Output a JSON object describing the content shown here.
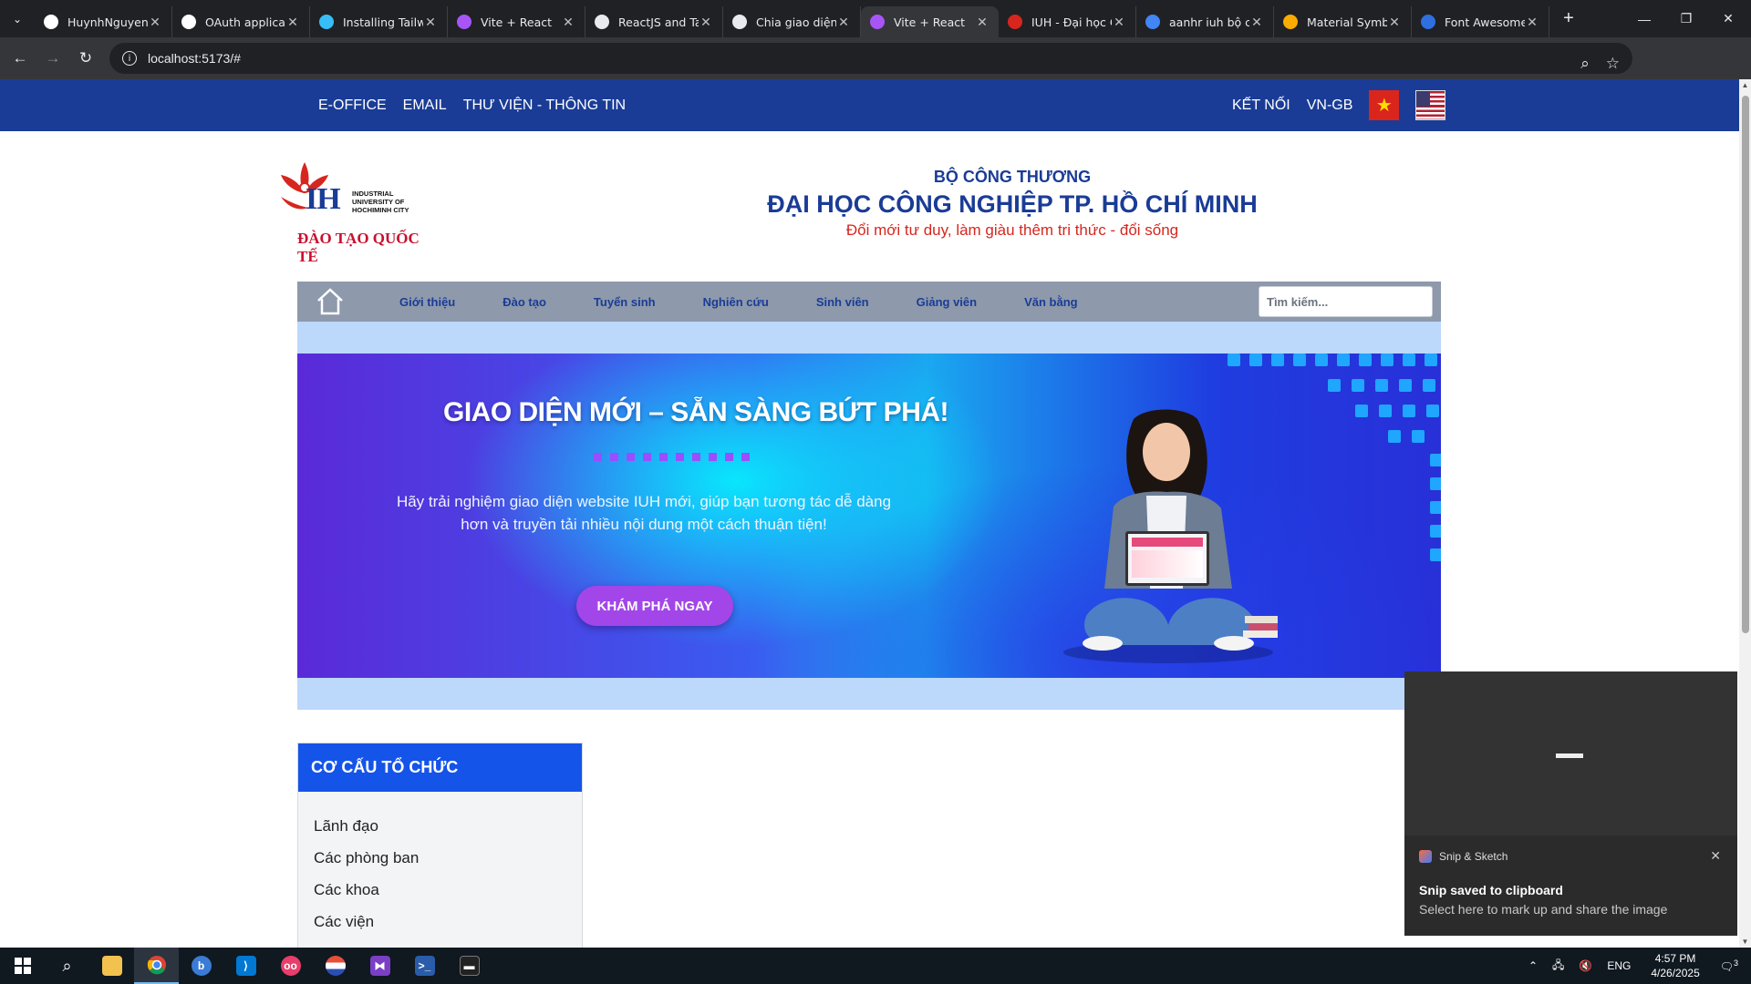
{
  "browser": {
    "tabs": [
      {
        "title": "HuynhNguyenl",
        "icon": "github-icon",
        "active": false
      },
      {
        "title": "OAuth applicat",
        "icon": "github-icon",
        "active": false
      },
      {
        "title": "Installing Tailw",
        "icon": "tailwind-icon",
        "active": false
      },
      {
        "title": "Vite + React",
        "icon": "vite-icon",
        "active": false
      },
      {
        "title": "ReactJS and Ta",
        "icon": "chatgpt-icon",
        "active": false
      },
      {
        "title": "Chia giao diện",
        "icon": "chatgpt-icon",
        "active": false
      },
      {
        "title": "Vite + React",
        "icon": "vite-icon",
        "active": true
      },
      {
        "title": "IUH - Đại học C",
        "icon": "iuh-icon",
        "active": false
      },
      {
        "title": "aanhr iuh bộ cô",
        "icon": "google-icon",
        "active": false
      },
      {
        "title": "Material Symb",
        "icon": "material-icon",
        "active": false
      },
      {
        "title": "Font Awesome",
        "icon": "fontawesome-icon",
        "active": false
      }
    ],
    "url": "localhost:5173/#"
  },
  "site": {
    "topbar": {
      "left_links": [
        "E-OFFICE",
        "EMAIL",
        "THƯ VIỆN - THÔNG TIN"
      ],
      "right_links": [
        "KẾT NỐI",
        "VN-GB"
      ]
    },
    "logo": {
      "mark": "IH",
      "university_lines": "INDUSTRIAL UNIVERSITY OF HOCHIMINH CITY",
      "tagline": "ĐÀO TẠO QUỐC TẾ"
    },
    "header": {
      "ministry": "BỘ CÔNG THƯƠNG",
      "university": "ĐẠI HỌC CÔNG NGHIỆP TP. HỒ CHÍ MINH",
      "slogan": "Đổi mới tư duy, làm giàu thêm tri thức - đổi sống"
    },
    "nav": {
      "items": [
        "Giới thiệu",
        "Đào tạo",
        "Tuyển sinh",
        "Nghiên cứu",
        "Sinh viên",
        "Giảng viên",
        "Văn bằng"
      ],
      "search_placeholder": "Tìm kiếm..."
    },
    "banner": {
      "title": "GIAO DIỆN MỚI – SẴN SÀNG BỨT PHÁ!",
      "description": "Hãy trải nghiệm giao diện website IUH mới, giúp bạn tương tác dễ dàng hơn và truyền tải nhiều nội dung một cách thuận tiện!",
      "cta": "KHÁM PHÁ NGAY"
    },
    "sidebar": {
      "title": "CƠ CẤU TỔ CHỨC",
      "items": [
        "Lãnh đạo",
        "Các phòng ban",
        "Các khoa",
        "Các viện"
      ]
    }
  },
  "toast": {
    "app": "Snip & Sketch",
    "heading": "Snip saved to clipboard",
    "body": "Select here to mark up and share the image"
  },
  "taskbar": {
    "language": "ENG",
    "time": "4:57 PM",
    "date": "4/26/2025",
    "notification_count": "3"
  },
  "colors": {
    "brand_blue": "#1a3c96",
    "brand_red": "#d7261e",
    "nav_bg": "#8e99ab",
    "sidebar_header": "#1554e8",
    "cta_purple": "#a246e9"
  }
}
